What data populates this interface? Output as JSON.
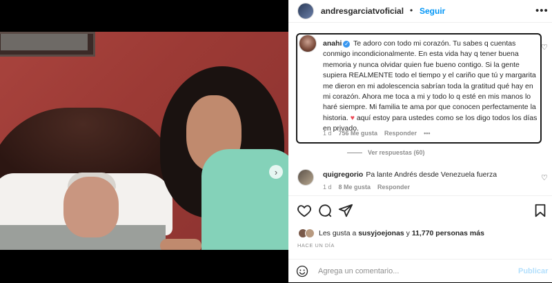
{
  "post": {
    "author": "andresgarciatvoficial",
    "separator": "•",
    "follow_label": "Seguir",
    "more_icon": "more-horizontal-icon"
  },
  "photo": {
    "next_icon": "chevron-right-icon",
    "carousel_count": 3,
    "carousel_active_index": 0
  },
  "highlighted_comment": {
    "username": "anahi",
    "verified": true,
    "text_before_heart": "Te adoro con todo mi corazón. Tu sabes q cuentas conmigo incondicionalmente. En esta vida hay q tener buena memoria y nunca olvidar quien fue bueno contigo. Si la gente supiera REALMENTE todo el tiempo y el cariño que tú y margarita me dieron en mi adolescencia sabrían toda la gratitud qué hay en mi corazón. Ahora me toca a mi y todo lo q esté en mis manos lo haré siempre. Mi familia te ama por que conocen perfectamente la historia.",
    "heart": "♥",
    "text_after_heart": "aquí estoy para ustedes como se los digo todos los días en privado.",
    "time": "1 d",
    "likes": "756 Me gusta",
    "reply_label": "Responder",
    "options": "•••",
    "view_replies": "Ver respuestas (60)"
  },
  "second_comment": {
    "username": "quigregorio",
    "text": "Pa lante Andrés desde Venezuela fuerza",
    "time": "1 d",
    "likes": "8 Me gusta",
    "reply_label": "Responder"
  },
  "actions": {
    "like_icon": "heart-icon",
    "comment_icon": "comment-icon",
    "share_icon": "share-icon",
    "save_icon": "bookmark-icon"
  },
  "likes_summary": {
    "prefix": "Les gusta a",
    "user": "susyjoejonas",
    "conjunction": "y",
    "others": "11,770 personas más"
  },
  "time_ago": "HACE UN DÍA",
  "comment_box": {
    "emoji_icon": "smiley-icon",
    "placeholder": "Agrega un comentario...",
    "value": "",
    "publish_label": "Publicar"
  },
  "colors": {
    "accent": "#0095f6",
    "publish_disabled": "#b2dffc",
    "heart_red": "#ed4956",
    "muted": "#8e8e8e"
  }
}
